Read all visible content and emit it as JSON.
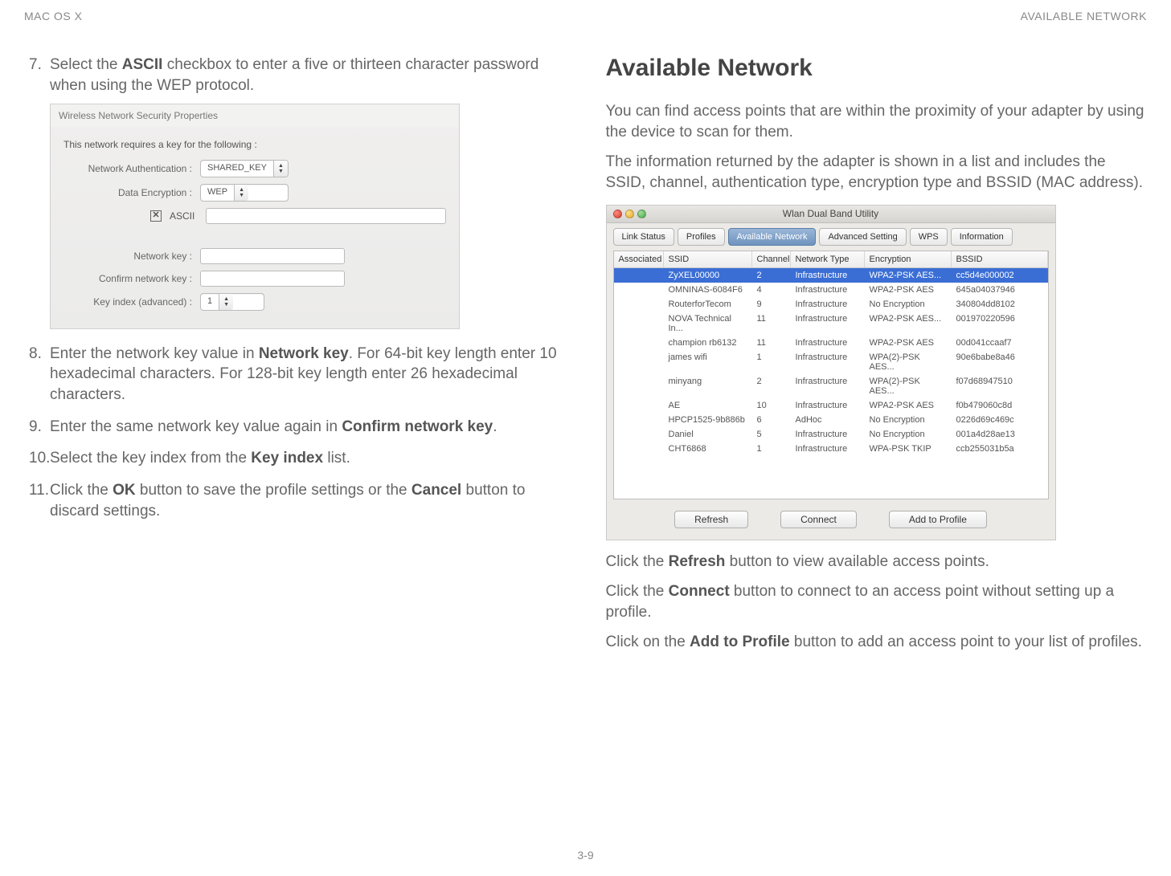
{
  "header": {
    "left": "MAC OS X",
    "right": "AVAILABLE NETWORK"
  },
  "footer": "3-9",
  "left": {
    "step7": {
      "num": "7.",
      "pre": "Select the ",
      "bold": "ASCII",
      "post": " checkbox to enter a five or thirteen character password when using the WEP protocol."
    },
    "dlg": {
      "title": "Wireless Network Security Properties",
      "intro": "This network requires a key for the following :",
      "auth_label": "Network Authentication :",
      "auth_value": "SHARED_KEY",
      "enc_label": "Data Encryption :",
      "enc_value": "WEP",
      "ascii_label": "ASCII",
      "netkey_label": "Network key :",
      "confirm_label": "Confirm network key :",
      "keyidx_label": "Key index (advanced) :",
      "keyidx_value": "1"
    },
    "step8": {
      "num": "8.",
      "pre": "Enter the network key value in ",
      "bold": "Network key",
      "post": ". For 64-bit key length enter 10 hexadecimal characters. For 128-bit key length enter 26 hexadecimal characters."
    },
    "step9": {
      "num": "9.",
      "pre": "Enter the same network key value again in ",
      "bold": "Confirm network key",
      "post": "."
    },
    "step10": {
      "num": "10.",
      "pre": "Select the key index from the ",
      "bold": "Key index",
      "post": " list."
    },
    "step11": {
      "num": "11.",
      "pre": "Click the ",
      "bold1": "OK",
      "mid": " button to save the profile settings or the ",
      "bold2": "Cancel",
      "post": " button to discard settings."
    }
  },
  "right": {
    "title": "Available Network",
    "p1": "You can find access points that are within the proximity of your adapter by using the device to scan for them.",
    "p2": "The information returned by the adapter is shown in a list and includes the SSID, channel, authentication type, encryption type and BSSID (MAC address).",
    "win": {
      "title": "Wlan Dual Band Utility",
      "tabs": [
        "Link Status",
        "Profiles",
        "Available Network",
        "Advanced Setting",
        "WPS",
        "Information"
      ],
      "cols": [
        "Associated",
        "SSID",
        "Channel",
        "Network Type",
        "Encryption",
        "BSSID"
      ],
      "rows": [
        {
          "ssid": "ZyXEL00000",
          "ch": "2",
          "type": "Infrastructure",
          "enc": "WPA2-PSK AES...",
          "bssid": "cc5d4e000002",
          "sel": true
        },
        {
          "ssid": "OMNINAS-6084F6",
          "ch": "4",
          "type": "Infrastructure",
          "enc": "WPA2-PSK AES",
          "bssid": "645a04037946"
        },
        {
          "ssid": "RouterforTecom",
          "ch": "9",
          "type": "Infrastructure",
          "enc": "No Encryption",
          "bssid": "340804dd8102"
        },
        {
          "ssid": "NOVA Technical In...",
          "ch": "11",
          "type": "Infrastructure",
          "enc": "WPA2-PSK AES...",
          "bssid": "001970220596"
        },
        {
          "ssid": "champion rb6132",
          "ch": "11",
          "type": "Infrastructure",
          "enc": "WPA2-PSK AES",
          "bssid": "00d041ccaaf7"
        },
        {
          "ssid": "james wifi",
          "ch": "1",
          "type": "Infrastructure",
          "enc": "WPA(2)-PSK AES...",
          "bssid": "90e6babe8a46"
        },
        {
          "ssid": "minyang",
          "ch": "2",
          "type": "Infrastructure",
          "enc": "WPA(2)-PSK AES...",
          "bssid": "f07d68947510"
        },
        {
          "ssid": "AE",
          "ch": "10",
          "type": "Infrastructure",
          "enc": "WPA2-PSK AES",
          "bssid": "f0b479060c8d"
        },
        {
          "ssid": "HPCP1525-9b886b",
          "ch": "6",
          "type": "AdHoc",
          "enc": "No Encryption",
          "bssid": "0226d69c469c"
        },
        {
          "ssid": "Daniel",
          "ch": "5",
          "type": "Infrastructure",
          "enc": "No Encryption",
          "bssid": "001a4d28ae13"
        },
        {
          "ssid": "CHT6868",
          "ch": "1",
          "type": "Infrastructure",
          "enc": "WPA-PSK TKIP",
          "bssid": "ccb255031b5a"
        }
      ],
      "btn_refresh": "Refresh",
      "btn_connect": "Connect",
      "btn_add": "Add to Profile"
    },
    "p3a": "Click the ",
    "p3b": "Refresh",
    "p3c": " button to view available access points.",
    "p4a": "Click the ",
    "p4b": "Connect",
    "p4c": " button to connect to an access point without setting up a profile.",
    "p5a": "Click on the ",
    "p5b": "Add to Profile",
    "p5c": " button to add an access point to your list of profiles."
  }
}
